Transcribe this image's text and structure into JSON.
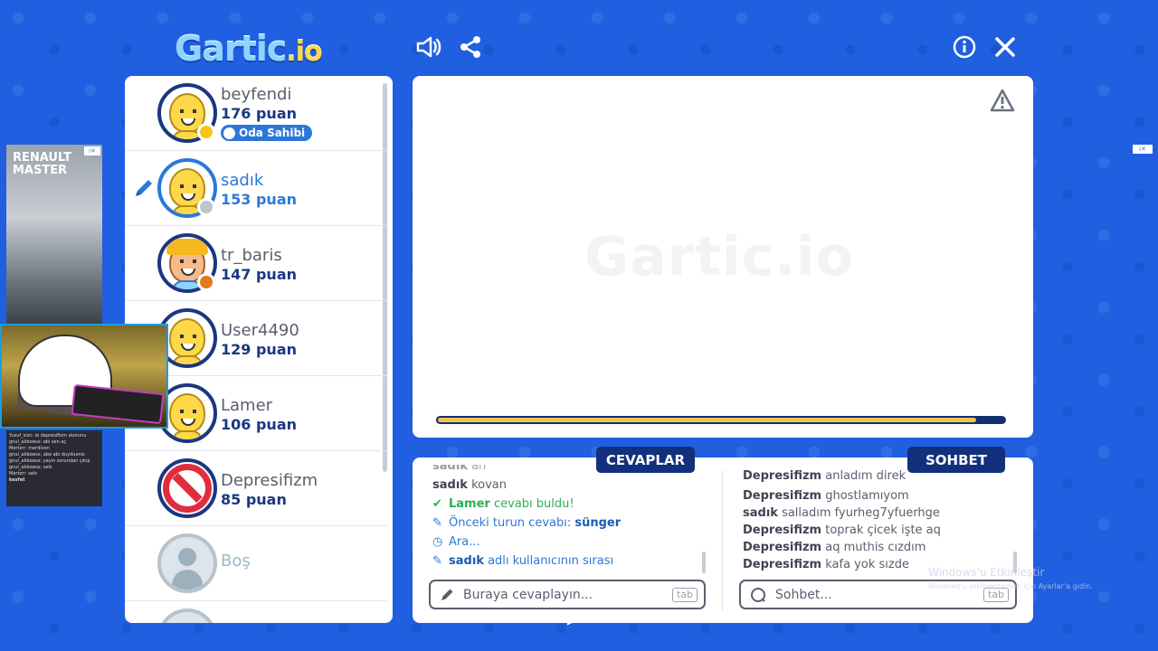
{
  "header": {
    "logo_main": "Gartic",
    "logo_suffix": ".io"
  },
  "players": [
    {
      "name": "beyfendi",
      "score": "176 puan",
      "badge": "Oda Sahibi",
      "avatar": "smiley",
      "status_color": "#f5c518"
    },
    {
      "name": "sadık",
      "score": "153 puan",
      "avatar": "smiley",
      "status_color": "#bfc4cc",
      "drawing": true
    },
    {
      "name": "tr_baris",
      "score": "147 puan",
      "avatar": "boy",
      "status_color": "#e07a1a"
    },
    {
      "name": "User4490",
      "score": "129 puan",
      "avatar": "smiley"
    },
    {
      "name": "Lamer",
      "score": "106 puan",
      "avatar": "smiley"
    },
    {
      "name": "Depresifizm",
      "score": "85 puan",
      "avatar": "forbidden"
    },
    {
      "name": "Boş",
      "avatar": "empty"
    }
  ],
  "canvas": {
    "watermark": "Gartic.io",
    "timer_progress": 0.95
  },
  "answers": {
    "title": "CEVAPLAR",
    "messages": [
      {
        "user": "sadık",
        "text": "an"
      },
      {
        "user": "sadık",
        "text": "kovan"
      },
      {
        "user": "Lamer",
        "text": "cevabı buldu!",
        "type": "correct"
      },
      {
        "text": "Önceki turun cevabı:",
        "highlight": "sünger",
        "type": "info"
      },
      {
        "text": "Ara...",
        "type": "pause"
      },
      {
        "user": "sadık",
        "text": "adlı kullanıcının sırası",
        "type": "turn"
      }
    ],
    "placeholder": "Buraya cevaplayın...",
    "shortcut": "tab"
  },
  "chat": {
    "title": "SOHBET",
    "messages": [
      {
        "user": "Depresifizm",
        "text": "anladım direk"
      },
      {
        "user": "Depresifizm",
        "text": "ghostlamıyom"
      },
      {
        "user": "sadık",
        "text": "salladım fyurheg7yfuerhge"
      },
      {
        "user": "Depresifizm",
        "text": "toprak çicek işte aq"
      },
      {
        "user": "Depresifizm",
        "text": "aq muthis cızdım"
      },
      {
        "user": "Depresifizm",
        "text": "kafa yok sızde"
      }
    ],
    "placeholder": "Sohbet...",
    "shortcut": "tab"
  },
  "overlays": {
    "ad_text_1": "RENAULT",
    "ad_text_2": "MASTER",
    "stream_chat": [
      "Yusuf_sizn: le depresifizm skorunu",
      "gnul_akbswss: abi sen aç",
      "Mertzrr: merdiven",
      "gnul_akbswss: abe abi duydueniz",
      "gnul_akbswss: yayın sorundan çıkıp",
      "gnul_akbswss: sels",
      "Mertzrr: sels",
      "kesfet"
    ],
    "windows_activate": "Windows'u Etkinleştir",
    "windows_activate_sub": "Windows'u etkinleştirmek için Ayarlar'a gidin."
  },
  "colors": {
    "background": "#1f5fe0",
    "navy": "#13307c",
    "blue_accent": "#2b78d8",
    "timer": "#f0c451",
    "correct": "#2ab050"
  }
}
